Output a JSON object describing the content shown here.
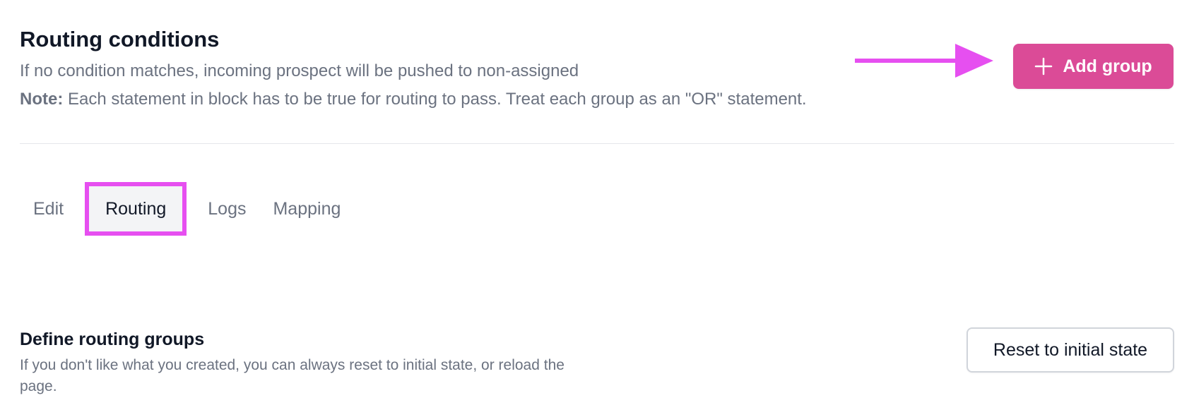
{
  "header": {
    "title": "Routing conditions",
    "subtitle": "If no condition matches, incoming prospect will be pushed to non-assigned",
    "note_label": "Note:",
    "note_text": " Each statement in block has to be true for routing to pass. Treat each group as an \"OR\" statement."
  },
  "actions": {
    "add_group_label": "Add group",
    "add_group_icon": "plus-icon"
  },
  "tabs": [
    {
      "label": "Edit",
      "active": false
    },
    {
      "label": "Routing",
      "active": true
    },
    {
      "label": "Logs",
      "active": false
    },
    {
      "label": "Mapping",
      "active": false
    }
  ],
  "routing_groups": {
    "title": "Define routing groups",
    "description": "If you don't like what you created, you can always reset to initial state, or reload the page.",
    "reset_label": "Reset to initial state"
  },
  "colors": {
    "primary_button": "#db4b97",
    "annotation": "#e64ff0",
    "muted_text": "#6b7280",
    "heading_text": "#111827"
  }
}
